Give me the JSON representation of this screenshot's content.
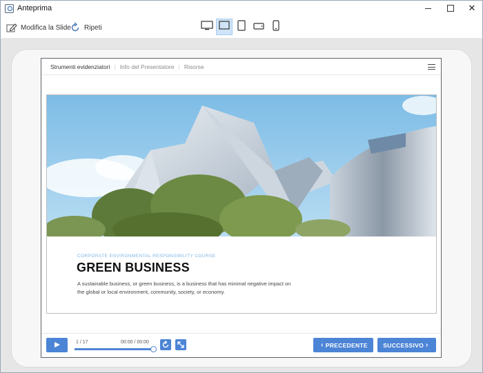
{
  "window": {
    "title": "Anteprima",
    "minimize": "",
    "maximize": "",
    "close": "✕"
  },
  "toolbar": {
    "edit_label": "Modifica la Slide",
    "repeat_label": "Ripeti",
    "devices": [
      "desktop-icon",
      "tablet-landscape-icon",
      "tablet-portrait-icon",
      "phone-landscape-icon",
      "phone-portrait-icon"
    ],
    "active_device": "tablet-landscape-icon"
  },
  "player": {
    "nav": [
      "Strumenti evidenziatori",
      "Info del Presentatore",
      "Risorse"
    ],
    "nav_sep": "|",
    "slide": {
      "course_label": "CORPORATE ENVIRONMENTAL RESPONSIBILITY COURSE",
      "title": "GREEN BUSINESS",
      "description": "A sustainable business, or green business, is a business that has minimal negative impact on the global or local environment, community, society, or economy."
    },
    "controls": {
      "slide_count": "1 / 17",
      "time": "00:00 / 00:00",
      "progress": 1.0,
      "prev_label": "PRECEDENTE",
      "next_label": "SUCCESSIVO",
      "prev_chevron": "‹",
      "next_chevron": "›"
    }
  },
  "colors": {
    "accent": "#4c84d6",
    "course_label": "#7fb6e4",
    "active_device_bg": "#cfe4f8"
  }
}
